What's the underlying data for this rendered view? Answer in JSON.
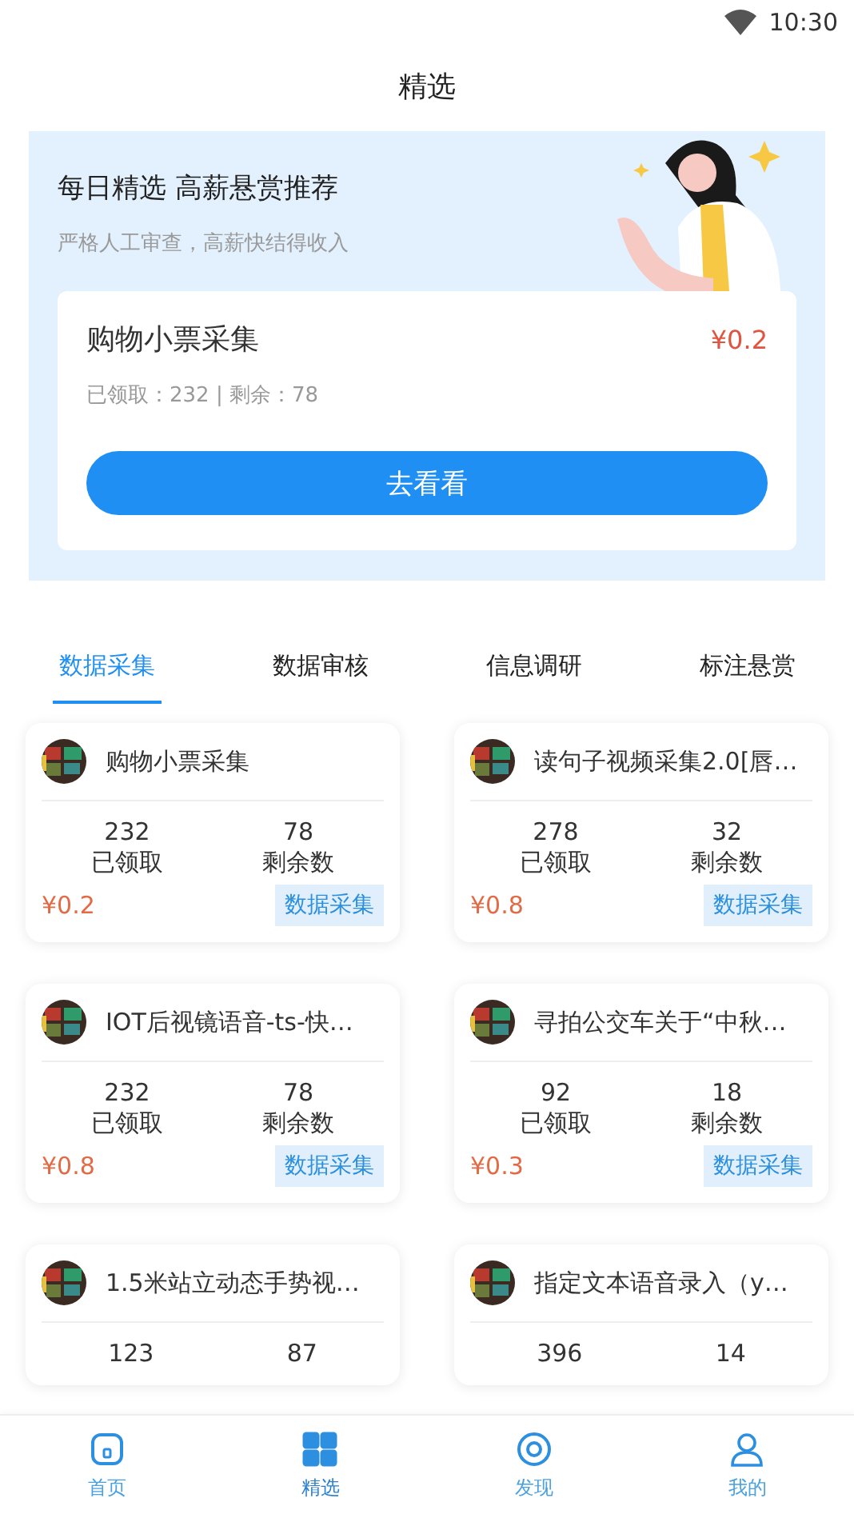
{
  "status_bar": {
    "time": "10:30"
  },
  "header": {
    "title": "精选"
  },
  "banner": {
    "title": "每日精选 高薪悬赏推荐",
    "subtitle": "严格人工审查，高薪快结得收入",
    "task": {
      "name": "购物小票采集",
      "price": "¥0.2",
      "stats": "已领取：232 | 剩余：78",
      "button": "去看看"
    }
  },
  "tabs": [
    {
      "label": "数据采集",
      "selected": true
    },
    {
      "label": "数据审核",
      "selected": false
    },
    {
      "label": "信息调研",
      "selected": false
    },
    {
      "label": "标注悬赏",
      "selected": false
    }
  ],
  "tasks": [
    {
      "name": "购物小票采集",
      "claimed": "232",
      "claimed_label": "已领取",
      "remaining": "78",
      "remaining_label": "剩余数",
      "price": "¥0.2",
      "tag": "数据采集"
    },
    {
      "name": "读句子视频采集2.0[唇…",
      "claimed": "278",
      "claimed_label": "已领取",
      "remaining": "32",
      "remaining_label": "剩余数",
      "price": "¥0.8",
      "tag": "数据采集"
    },
    {
      "name": "IOT后视镜语音-ts-快…",
      "claimed": "232",
      "claimed_label": "已领取",
      "remaining": "78",
      "remaining_label": "剩余数",
      "price": "¥0.8",
      "tag": "数据采集"
    },
    {
      "name": "寻拍公交车关于“中秋…",
      "claimed": "92",
      "claimed_label": "已领取",
      "remaining": "18",
      "remaining_label": "剩余数",
      "price": "¥0.3",
      "tag": "数据采集"
    },
    {
      "name": "1.5米站立动态手势视…",
      "claimed": "123",
      "remaining": "87"
    },
    {
      "name": "指定文本语音录入（y…",
      "claimed": "396",
      "remaining": "14"
    }
  ],
  "bottom_nav": [
    {
      "label": "首页",
      "kind": "home",
      "selected": false
    },
    {
      "label": "精选",
      "kind": "grid",
      "selected": true
    },
    {
      "label": "发现",
      "kind": "discover",
      "selected": false
    },
    {
      "label": "我的",
      "kind": "profile",
      "selected": false
    }
  ]
}
